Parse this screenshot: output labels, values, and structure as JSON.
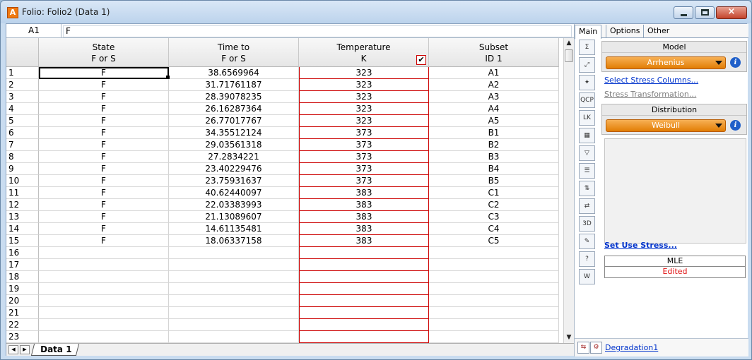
{
  "window": {
    "title": "Folio: Folio2 (Data 1)",
    "app_icon_glyph": "A",
    "close_glyph": "×"
  },
  "formula_bar": {
    "cell_ref": "A1",
    "value": "F"
  },
  "grid": {
    "columns": [
      {
        "line1": "State",
        "line2": "F or S"
      },
      {
        "line1": "Time to",
        "line2": "F or S"
      },
      {
        "line1": "Temperature",
        "line2": "K"
      },
      {
        "line1": "Subset",
        "line2": "ID 1"
      }
    ],
    "temperature_check": "✔",
    "rows": [
      {
        "n": "1",
        "state": "F",
        "time": "38.6569964",
        "temp": "323",
        "subset": "A1"
      },
      {
        "n": "2",
        "state": "F",
        "time": "31.71761187",
        "temp": "323",
        "subset": "A2"
      },
      {
        "n": "3",
        "state": "F",
        "time": "28.39078235",
        "temp": "323",
        "subset": "A3"
      },
      {
        "n": "4",
        "state": "F",
        "time": "26.16287364",
        "temp": "323",
        "subset": "A4"
      },
      {
        "n": "5",
        "state": "F",
        "time": "26.77017767",
        "temp": "323",
        "subset": "A5"
      },
      {
        "n": "6",
        "state": "F",
        "time": "34.35512124",
        "temp": "373",
        "subset": "B1"
      },
      {
        "n": "7",
        "state": "F",
        "time": "29.03561318",
        "temp": "373",
        "subset": "B2"
      },
      {
        "n": "8",
        "state": "F",
        "time": "27.2834221",
        "temp": "373",
        "subset": "B3"
      },
      {
        "n": "9",
        "state": "F",
        "time": "23.40229476",
        "temp": "373",
        "subset": "B4"
      },
      {
        "n": "10",
        "state": "F",
        "time": "23.75931637",
        "temp": "373",
        "subset": "B5"
      },
      {
        "n": "11",
        "state": "F",
        "time": "40.62440097",
        "temp": "383",
        "subset": "C1"
      },
      {
        "n": "12",
        "state": "F",
        "time": "22.03383993",
        "temp": "383",
        "subset": "C2"
      },
      {
        "n": "13",
        "state": "F",
        "time": "21.13089607",
        "temp": "383",
        "subset": "C3"
      },
      {
        "n": "14",
        "state": "F",
        "time": "14.61135481",
        "temp": "383",
        "subset": "C4"
      },
      {
        "n": "15",
        "state": "F",
        "time": "18.06337158",
        "temp": "383",
        "subset": "C5"
      },
      {
        "n": "16",
        "state": "",
        "time": "",
        "temp": "",
        "subset": ""
      },
      {
        "n": "17",
        "state": "",
        "time": "",
        "temp": "",
        "subset": ""
      },
      {
        "n": "18",
        "state": "",
        "time": "",
        "temp": "",
        "subset": ""
      },
      {
        "n": "19",
        "state": "",
        "time": "",
        "temp": "",
        "subset": ""
      },
      {
        "n": "20",
        "state": "",
        "time": "",
        "temp": "",
        "subset": ""
      },
      {
        "n": "21",
        "state": "",
        "time": "",
        "temp": "",
        "subset": ""
      },
      {
        "n": "22",
        "state": "",
        "time": "",
        "temp": "",
        "subset": ""
      },
      {
        "n": "23",
        "state": "",
        "time": "",
        "temp": "",
        "subset": ""
      }
    ]
  },
  "scroll": {
    "up": "▲",
    "down": "▼"
  },
  "sheet_tabs": {
    "first": "|◀",
    "prev": "◀",
    "active": "Data 1"
  },
  "side_panel": {
    "tabs": [
      "Main",
      "Options",
      "Other"
    ],
    "model": {
      "title": "Model",
      "value": "Arrhenius"
    },
    "select_stress_columns": "Select Stress Columns...",
    "stress_transformation": "Stress Transformation...",
    "distribution": {
      "title": "Distribution",
      "value": "Weibull"
    },
    "set_use_stress": "Set Use Stress...",
    "method": "MLE",
    "status": "Edited",
    "info_glyph": "i",
    "tools": [
      {
        "name": "calculate-icon",
        "glyph": "Σ"
      },
      {
        "name": "plot-icon",
        "glyph": "⤢"
      },
      {
        "name": "wizard-icon",
        "glyph": "✦"
      },
      {
        "name": "qcp-icon",
        "glyph": "QCP"
      },
      {
        "name": "lk-icon",
        "glyph": "LK"
      },
      {
        "name": "probability-grid-icon",
        "glyph": "▦"
      },
      {
        "name": "filter-icon",
        "glyph": "▽"
      },
      {
        "name": "report-icon",
        "glyph": "☰"
      },
      {
        "name": "sort-icon",
        "glyph": "⇅"
      },
      {
        "name": "transfer-icon",
        "glyph": "⇄"
      },
      {
        "name": "3d-plot-icon",
        "glyph": "3D"
      },
      {
        "name": "clear-icon",
        "glyph": "✎"
      },
      {
        "name": "help-icon",
        "glyph": "?"
      },
      {
        "name": "word-export-icon",
        "glyph": "W"
      }
    ],
    "bottom_link": "Degradation1"
  },
  "colors": {
    "accent_orange": "#e27d05",
    "link_blue": "#0033cc",
    "temperature_border": "#cc0000",
    "edited_red": "#e01010"
  }
}
